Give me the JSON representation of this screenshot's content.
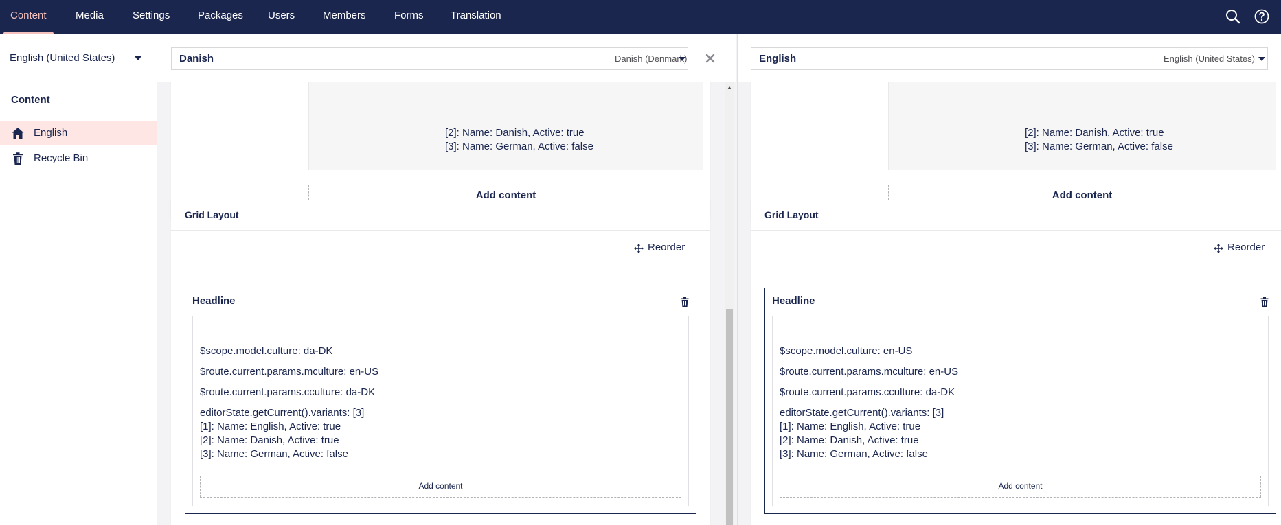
{
  "nav": {
    "items": [
      "Content",
      "Media",
      "Settings",
      "Packages",
      "Users",
      "Members",
      "Forms",
      "Translation"
    ],
    "active_index": 0,
    "search_icon": "search-icon",
    "help_icon": "help-icon"
  },
  "colors": {
    "nav_bg": "#1b264f",
    "nav_active": "#f5c1bc",
    "selected_tree_bg": "#fde6e4"
  },
  "sidebar": {
    "language": "English (United States)",
    "section_title": "Content",
    "tree": [
      {
        "label": "English",
        "icon": "home-icon",
        "selected": true
      },
      {
        "label": "Recycle Bin",
        "icon": "trash-icon",
        "selected": false
      }
    ]
  },
  "left": {
    "variant_name": "Danish",
    "variant_culture": "Danish (Denmark)",
    "top_lines": [
      "[2]: Name: Danish, Active: true",
      "[3]: Name: German, Active: false"
    ],
    "add_content": "Add content",
    "grid_title": "Grid Layout",
    "reorder": "Reorder",
    "headline": "Headline",
    "lines": [
      "$scope.model.culture: da-DK",
      "$route.current.params.mculture: en-US",
      "$route.current.params.cculture: da-DK",
      "editorState.getCurrent().variants: [3]",
      "[1]: Name: English, Active: true",
      "[2]: Name: Danish, Active: true",
      "[3]: Name: German, Active: false"
    ],
    "inner_add_content": "Add content"
  },
  "right": {
    "variant_name": "English",
    "variant_culture": "English (United States)",
    "top_lines": [
      "[2]: Name: Danish, Active: true",
      "[3]: Name: German, Active: false"
    ],
    "add_content": "Add content",
    "grid_title": "Grid Layout",
    "reorder": "Reorder",
    "headline": "Headline",
    "lines": [
      "$scope.model.culture: en-US",
      "$route.current.params.mculture: en-US",
      "$route.current.params.cculture: da-DK",
      "editorState.getCurrent().variants: [3]",
      "[1]: Name: English, Active: true",
      "[2]: Name: Danish, Active: true",
      "[3]: Name: German, Active: false"
    ],
    "inner_add_content": "Add content"
  }
}
